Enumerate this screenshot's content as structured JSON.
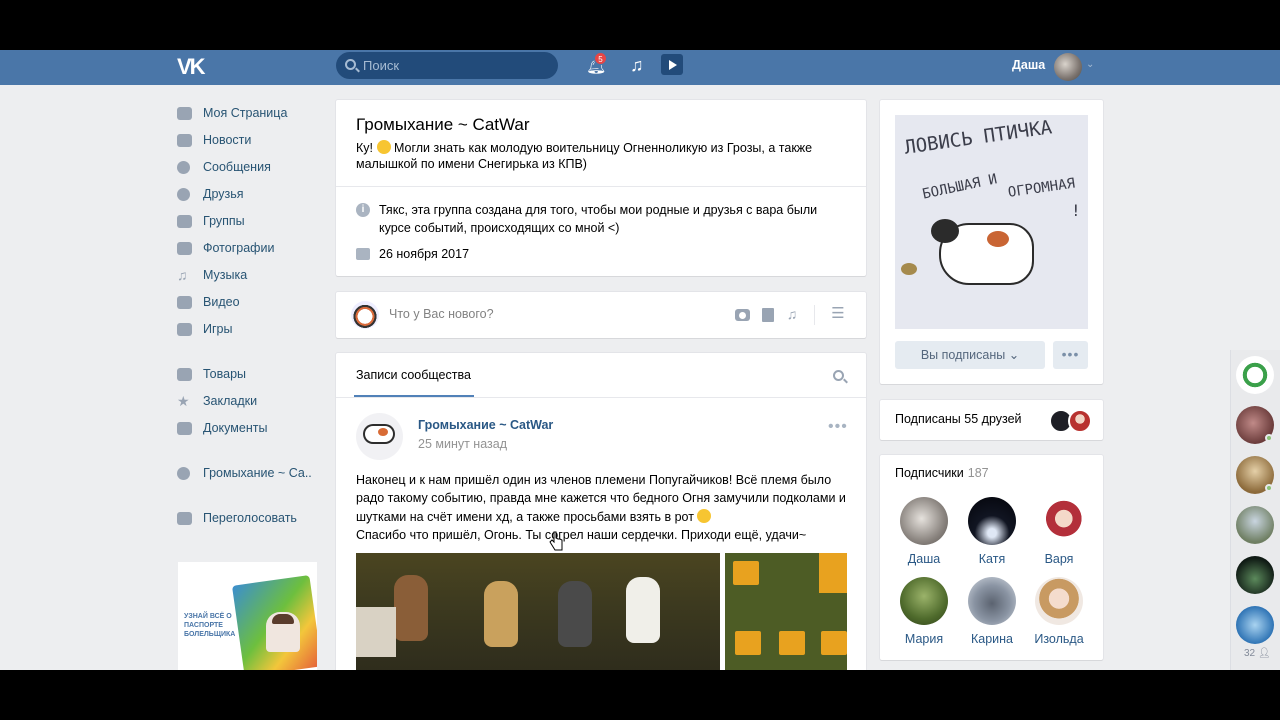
{
  "header": {
    "logo": "VK",
    "search_placeholder": "Поиск",
    "notifications_badge": "5",
    "user_name": "Даша"
  },
  "sidebar": {
    "items": [
      {
        "label": "Моя Страница",
        "icon": "home-icon"
      },
      {
        "label": "Новости",
        "icon": "news-icon"
      },
      {
        "label": "Сообщения",
        "icon": "messages-icon"
      },
      {
        "label": "Друзья",
        "icon": "friends-icon"
      },
      {
        "label": "Группы",
        "icon": "groups-icon"
      },
      {
        "label": "Фотографии",
        "icon": "photo-icon"
      },
      {
        "label": "Музыка",
        "icon": "music-icon"
      },
      {
        "label": "Видео",
        "icon": "video-icon"
      },
      {
        "label": "Игры",
        "icon": "games-icon"
      }
    ],
    "items2": [
      {
        "label": "Товары",
        "icon": "goods-icon"
      },
      {
        "label": "Закладки",
        "icon": "star-icon"
      },
      {
        "label": "Документы",
        "icon": "document-icon"
      }
    ],
    "group_link": "Громыхание ~ Са..",
    "app_link": "Переголосовать",
    "ad_text": "УЗНАЙ ВСЁ О ПАСПОРТЕ БОЛЕЛЬЩИКА"
  },
  "group": {
    "title": "Громыхание ~ CatWar",
    "status": "Ку! 😊 Могли знать как молодую воительницу Огненноликую из Грозы, а также малышкой по имени Снегирька из КПВ)",
    "status_prefix": "Ку!",
    "status_rest": " Могли знать как молодую воительницу Огненноликую из Грозы, а также малышкой по имени Снегирька из КПВ)",
    "description": "Тякс, эта группа создана для того, чтобы мои родные и друзья с вара были курсе событий, происходящих со мной <)",
    "created": "26 ноября 2017"
  },
  "composer": {
    "placeholder": "Что у Вас нового?"
  },
  "wall": {
    "tab": "Записи сообщества",
    "post": {
      "author": "Громыхание ~ CatWar",
      "time": "25 минут назад",
      "text_part1": "Наконец и к нам пришёл один из членов племени Попугайчиков! Всё племя было радо такому событию, правда мне кажется что бедного Огня замучили подколами и шутками на счёт имени хд, а также просьбами взять в рот ",
      "text_part2": "Спасибо что пришёл, Огонь. Ты согрел наши сердечки. Приходи ещё, удачи~"
    }
  },
  "aside": {
    "cover_line1": "ЛОВИСЬ ПТИЧКА",
    "cover_line2": "БОЛЬШАЯ И",
    "cover_line3": "ОГРОМНАЯ",
    "cover_line4": "!",
    "subscribed_button": "Вы подписаны",
    "friends_subscribed": "Подписаны 55 друзей",
    "subscribers_title": "Подписчики",
    "subscribers_count": "187",
    "subscribers": [
      "Даша",
      "Катя",
      "Варя",
      "Мария",
      "Карина",
      "Изольда"
    ]
  },
  "rail": {
    "count": "32"
  },
  "colors": {
    "header": "#4a76a8",
    "link": "#2a5885",
    "page_bg": "#edeef0"
  }
}
